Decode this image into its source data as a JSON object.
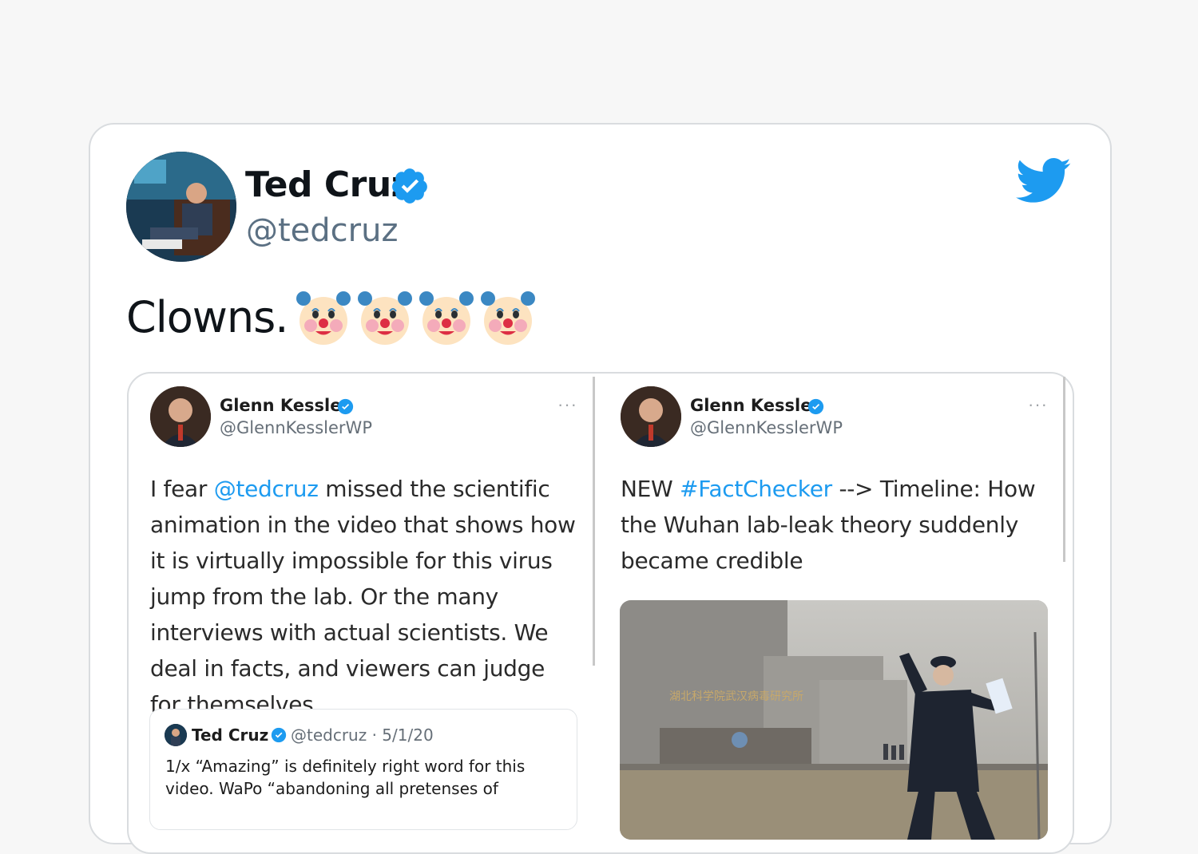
{
  "tweet": {
    "author_name": "Ted Cruz",
    "author_handle": "@tedcruz",
    "text": "Clowns.",
    "emojis": [
      "clown-face",
      "clown-face",
      "clown-face",
      "clown-face"
    ]
  },
  "embedded": {
    "left": {
      "author_name": "Glenn Kessler",
      "author_handle": "@GlennKesslerWP",
      "more": "···",
      "text_pre": "I fear ",
      "mention": "@tedcruz",
      "text_post": " missed the scientific animation in the video that shows how it is virtually impossible for this virus jump from the lab. Or the many interviews with actual scientists. We deal in facts, and viewers can judge for themselves.",
      "quoted": {
        "author_name": "Ted Cruz",
        "author_handle": "@tedcruz · 5/1/20",
        "text": "1/x “Amazing” is definitely right word for this video. WaPo “abandoning all pretenses of"
      }
    },
    "right": {
      "author_name": "Glenn Kessler",
      "author_handle": "@GlennKesslerWP",
      "more": "···",
      "text_pre": "NEW ",
      "hashtag": "#FactChecker",
      "text_post": " -->  Timeline: How the Wuhan lab-leak theory suddenly became credible",
      "photo_sign": "湖北科学院武汉病毒研究所"
    }
  },
  "colors": {
    "accent": "#1d9bf0",
    "background": "#f7f7f7",
    "card": "#ffffff",
    "text_primary": "#0f1419",
    "text_secondary": "#5b7083"
  }
}
